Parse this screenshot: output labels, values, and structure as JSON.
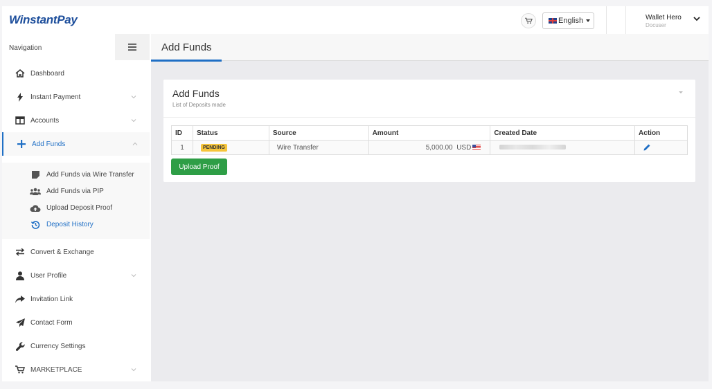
{
  "header": {
    "logo": "WinstantPay",
    "language": "English",
    "user_name": "Wallet Hero",
    "user_role": "Docuser"
  },
  "sidebar": {
    "nav_label": "Navigation",
    "items": [
      {
        "label": "Dashboard",
        "icon": "home-icon"
      },
      {
        "label": "Instant Payment",
        "icon": "bolt-icon"
      },
      {
        "label": "Accounts",
        "icon": "columns-icon"
      },
      {
        "label": "Add Funds",
        "icon": "plus-icon"
      },
      {
        "label": "Convert & Exchange",
        "icon": "exchange-icon"
      },
      {
        "label": "User Profile",
        "icon": "user-icon"
      },
      {
        "label": "Invitation Link",
        "icon": "share-icon"
      },
      {
        "label": "Contact Form",
        "icon": "send-icon"
      },
      {
        "label": "Currency Settings",
        "icon": "wrench-icon"
      },
      {
        "label": "MARKETPLACE",
        "icon": "cart-icon"
      }
    ],
    "sub_items": [
      {
        "label": "Add Funds via Wire Transfer",
        "icon": "note-icon"
      },
      {
        "label": "Add Funds via PIP",
        "icon": "users-icon"
      },
      {
        "label": "Upload Deposit Proof",
        "icon": "cloud-upload-icon"
      },
      {
        "label": "Deposit History",
        "icon": "history-icon"
      }
    ]
  },
  "page": {
    "title": "Add Funds"
  },
  "card": {
    "title": "Add Funds",
    "subtitle": "List of Deposits made",
    "table": {
      "headers": [
        "ID",
        "Status",
        "Source",
        "Amount",
        "Created Date",
        "Action"
      ],
      "rows": [
        {
          "id": "1",
          "status": "PENDING",
          "source": "Wire Transfer",
          "amount": "5,000.00",
          "currency": "USD"
        }
      ]
    },
    "upload_button": "Upload Proof"
  },
  "colors": {
    "accent": "#1f6fc5",
    "success": "#2e9e46",
    "pending": "#f6c53b",
    "brand": "#1e4f9c"
  }
}
